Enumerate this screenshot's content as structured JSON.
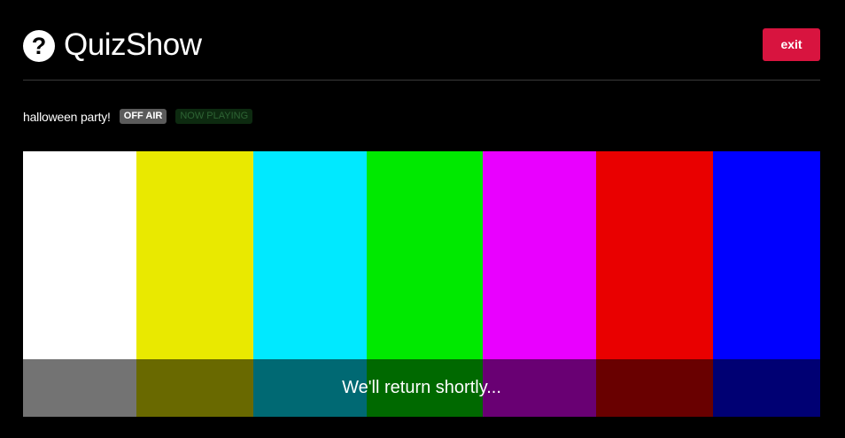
{
  "header": {
    "logo_glyph": "?",
    "title": "QuizShow",
    "exit_label": "exit"
  },
  "status": {
    "show_name": "halloween party!",
    "off_air_label": "OFF AIR",
    "now_playing_label": "NOW PLAYING"
  },
  "screen": {
    "message": "We'll return shortly...",
    "color_bars": [
      "#ffffff",
      "#e9e900",
      "#00e9ff",
      "#00e900",
      "#e900ff",
      "#e90000",
      "#0000ff"
    ]
  },
  "colors": {
    "background": "#000000",
    "exit_button": "#d8143f",
    "off_air_badge": "#5b5b5b",
    "now_playing_badge": "#0d2a10"
  }
}
